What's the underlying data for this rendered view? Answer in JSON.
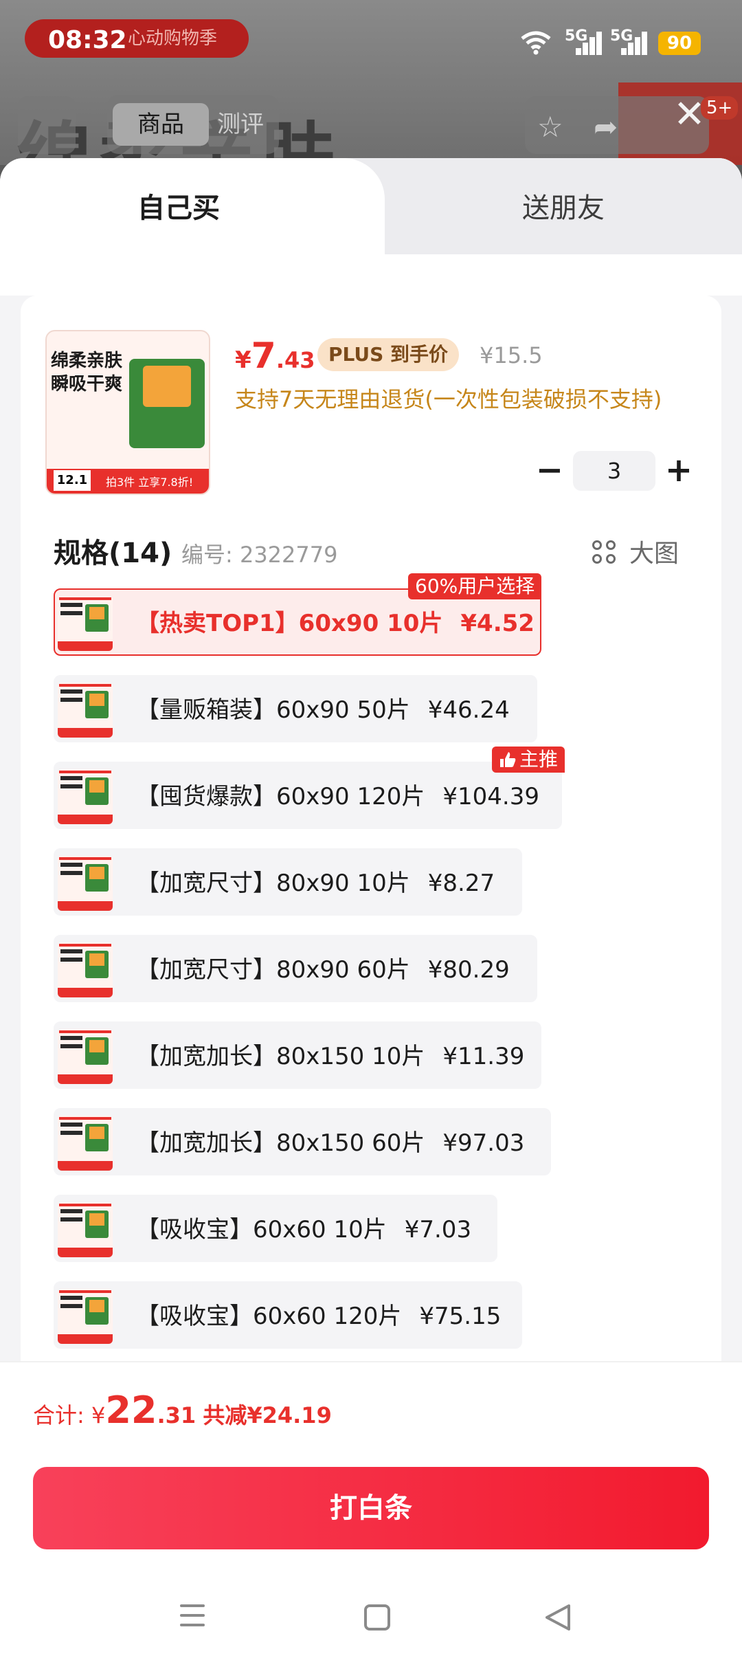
{
  "status_bar": {
    "time": "08:32",
    "sig1": "5G",
    "sig2": "5G",
    "battery": "90"
  },
  "background": {
    "banner": "心动购物季",
    "title": "绵柔亲肤",
    "tab_goods": "商品",
    "tab_review": "测评",
    "badge": "5+"
  },
  "tabs": {
    "self": "自己买",
    "friend": "送朋友"
  },
  "product": {
    "thumb_line1": "绵柔亲肤",
    "thumb_line2": "瞬吸干爽",
    "thumb_price": "12.1",
    "thumb_offer": "拍3件 立享7.8折!",
    "price_symbol": "¥",
    "price_int": "7",
    "price_dec": ".43",
    "plus_label": "PLUS 到手价",
    "original_price": "¥15.5",
    "return_note": "支持7天无理由退货(一次性包装破损不支持)"
  },
  "quantity": {
    "minus": "−",
    "value": "3",
    "plus": "+"
  },
  "spec": {
    "heading": "规格(14)",
    "code": "编号: 2322779",
    "big_view": "大图",
    "options": [
      {
        "label": "【热卖TOP1】60x90 10片",
        "price": "¥4.52",
        "tag": "60%用户选择"
      },
      {
        "label": "【量贩箱装】60x90 50片",
        "price": "¥46.24"
      },
      {
        "label": "【囤货爆款】60x90 120片",
        "price": "¥104.39",
        "tag": "主推"
      },
      {
        "label": "【加宽尺寸】80x90 10片",
        "price": "¥8.27"
      },
      {
        "label": "【加宽尺寸】80x90 60片",
        "price": "¥80.29"
      },
      {
        "label": "【加宽加长】80x150 10片",
        "price": "¥11.39"
      },
      {
        "label": "【加宽加长】80x150 60片",
        "price": "¥97.03"
      },
      {
        "label": "【吸收宝】60x60 10片",
        "price": "¥7.03"
      },
      {
        "label": "【吸收宝】60x60 120片",
        "price": "¥75.15"
      }
    ]
  },
  "total": {
    "label": "合计: ¥",
    "int": "22",
    "dec": ".31",
    "cut": "共减¥24.19"
  },
  "pay_button": "打白条",
  "colors": {
    "accent": "#e8302c",
    "plus_bg": "#fae2c8",
    "note": "#c6861a"
  }
}
